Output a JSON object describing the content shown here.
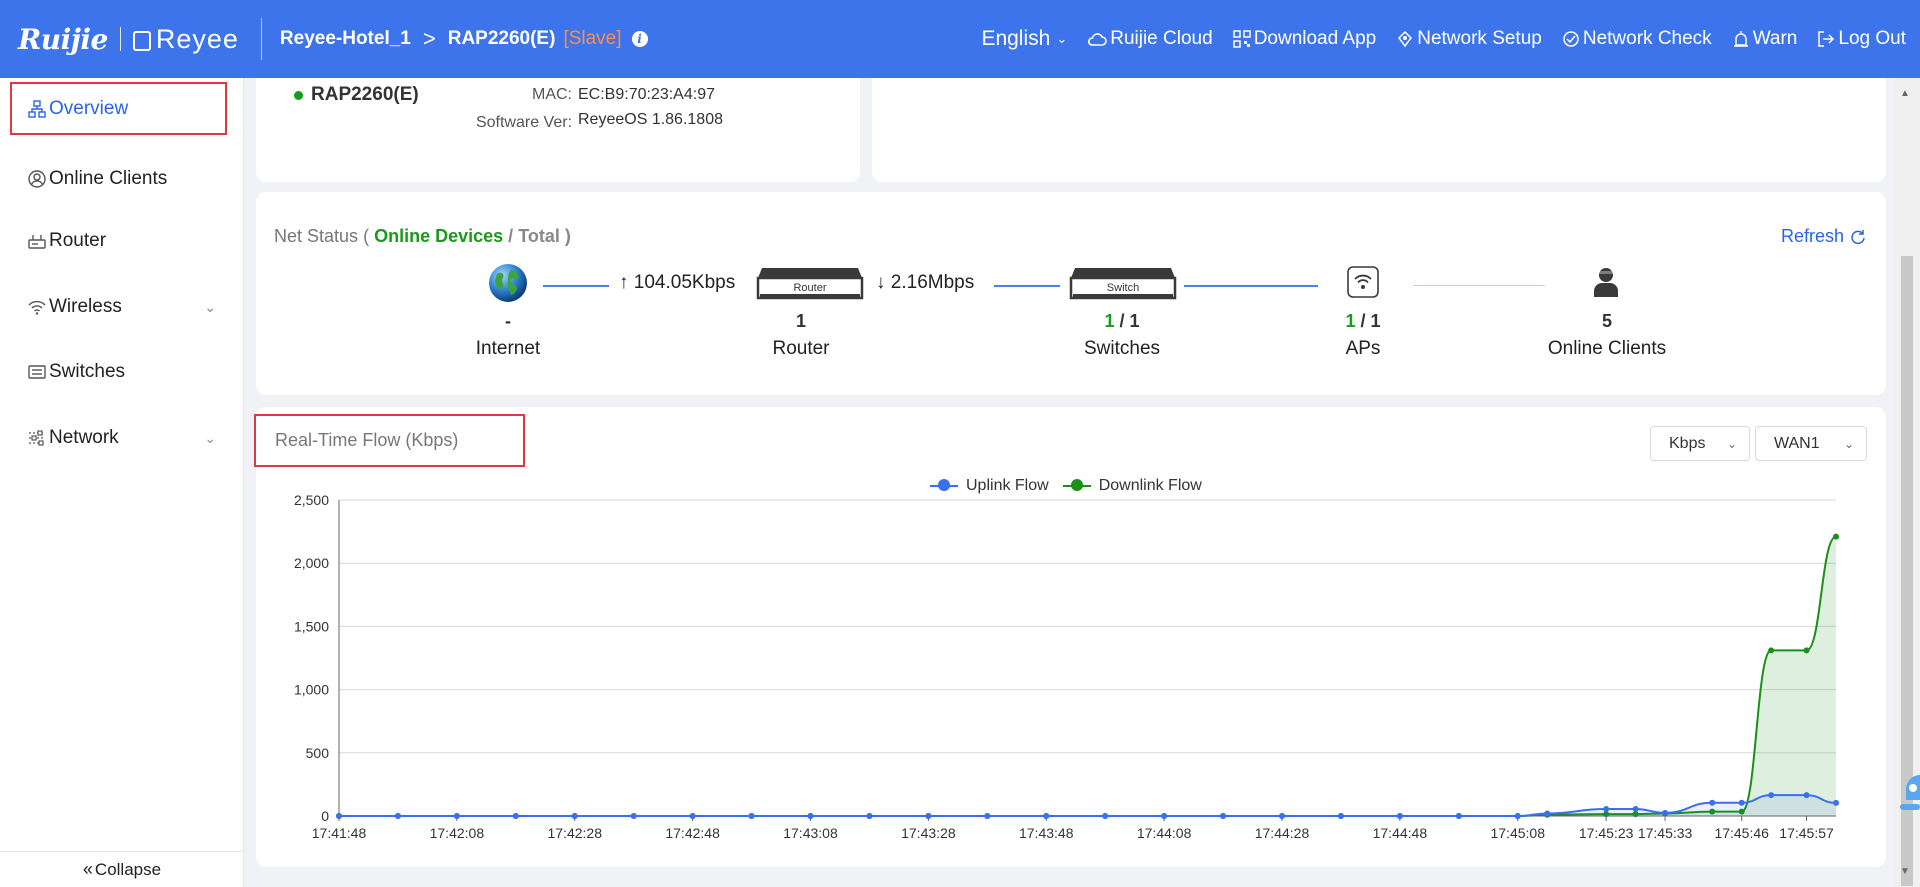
{
  "header": {
    "logo_brand": "Ruijie",
    "logo_product": "Reyee",
    "breadcrumb_site": "Reyee-Hotel_1",
    "breadcrumb_arrow": ">",
    "breadcrumb_device": "RAP2260(E)",
    "breadcrumb_role": "[Slave]",
    "info_icon": "i",
    "nav": {
      "language": "English",
      "ruijie_cloud": "Ruijie Cloud",
      "download_app": "Download App",
      "network_setup": "Network Setup",
      "network_check": "Network Check",
      "warn": "Warn",
      "log_out": "Log Out"
    },
    "color": "#3d74ec"
  },
  "sidebar": {
    "items": [
      {
        "label": "Overview",
        "icon": "topology-icon",
        "active": true
      },
      {
        "label": "Online Clients",
        "icon": "user-circle-icon"
      },
      {
        "label": "Router",
        "icon": "router-icon"
      },
      {
        "label": "Wireless",
        "icon": "wifi-icon",
        "expandable": true
      },
      {
        "label": "Switches",
        "icon": "switch-icon"
      },
      {
        "label": "Network",
        "icon": "sliders-icon",
        "expandable": true
      }
    ],
    "collapse_label": "Collapse"
  },
  "device": {
    "name": "RAP2260(E)",
    "mac_label": "MAC:",
    "mac_value": "EC:B9:70:23:A4:97",
    "software_label": "Software Ver:",
    "software_value": "ReyeeOS 1.86.1808"
  },
  "net_status": {
    "title_prefix": "Net Status",
    "title_open": "(",
    "title_online": "Online Devices",
    "title_slash": "/",
    "title_total": "Total",
    "title_close": ")",
    "refresh_label": "Refresh",
    "uplink_speed": "104.05Kbps",
    "downlink_speed": "2.16Mbps",
    "internet": {
      "value": "-",
      "label": "Internet"
    },
    "router": {
      "value": "1",
      "label": "Router",
      "device_text": "Router"
    },
    "switches": {
      "online": "1",
      "total": "1",
      "label": "Switches",
      "device_text": "Switch"
    },
    "aps": {
      "online": "1",
      "total": "1",
      "label": "APs"
    },
    "clients": {
      "value": "5",
      "label": "Online Clients"
    }
  },
  "flow": {
    "title": "Real-Time Flow (Kbps)",
    "unit_select": "Kbps",
    "wan_select": "WAN1"
  },
  "chart_data": {
    "type": "line",
    "title": "Real-Time Flow (Kbps)",
    "x": [
      "17:41:48",
      "17:41:58",
      "17:42:08",
      "17:42:18",
      "17:42:28",
      "17:42:38",
      "17:42:48",
      "17:42:58",
      "17:43:08",
      "17:43:18",
      "17:43:28",
      "17:43:38",
      "17:43:48",
      "17:43:58",
      "17:44:08",
      "17:44:18",
      "17:44:28",
      "17:44:38",
      "17:44:48",
      "17:44:58",
      "17:45:08",
      "17:45:13",
      "17:45:23",
      "17:45:28",
      "17:45:33",
      "17:45:41",
      "17:45:46",
      "17:45:51",
      "17:45:57",
      "17:46:02"
    ],
    "x_tick_labels": [
      "17:41:48",
      "17:42:08",
      "17:42:28",
      "17:42:48",
      "17:43:08",
      "17:43:28",
      "17:43:48",
      "17:44:08",
      "17:44:28",
      "17:44:48",
      "17:45:08",
      "17:45:23",
      "17:45:33",
      "17:45:46",
      "17:45:57"
    ],
    "y_tick_labels": [
      "0",
      "500",
      "1,000",
      "1,500",
      "2,000",
      "2,500"
    ],
    "ylim": [
      0,
      2500
    ],
    "grid": true,
    "legend_position": "top-center",
    "series": [
      {
        "name": "Uplink Flow",
        "color": "#3a6ff0",
        "values": [
          0,
          0,
          0,
          0,
          0,
          0,
          0,
          0,
          0,
          0,
          0,
          0,
          0,
          0,
          0,
          0,
          0,
          0,
          0,
          0,
          0,
          20,
          55,
          55,
          25,
          105,
          105,
          165,
          165,
          104
        ]
      },
      {
        "name": "Downlink Flow",
        "color": "#1a8f1a",
        "values": [
          0,
          0,
          0,
          0,
          0,
          0,
          0,
          0,
          0,
          0,
          0,
          0,
          0,
          0,
          0,
          0,
          0,
          0,
          0,
          0,
          0,
          10,
          15,
          15,
          20,
          35,
          35,
          1310,
          1310,
          2210
        ]
      }
    ]
  }
}
